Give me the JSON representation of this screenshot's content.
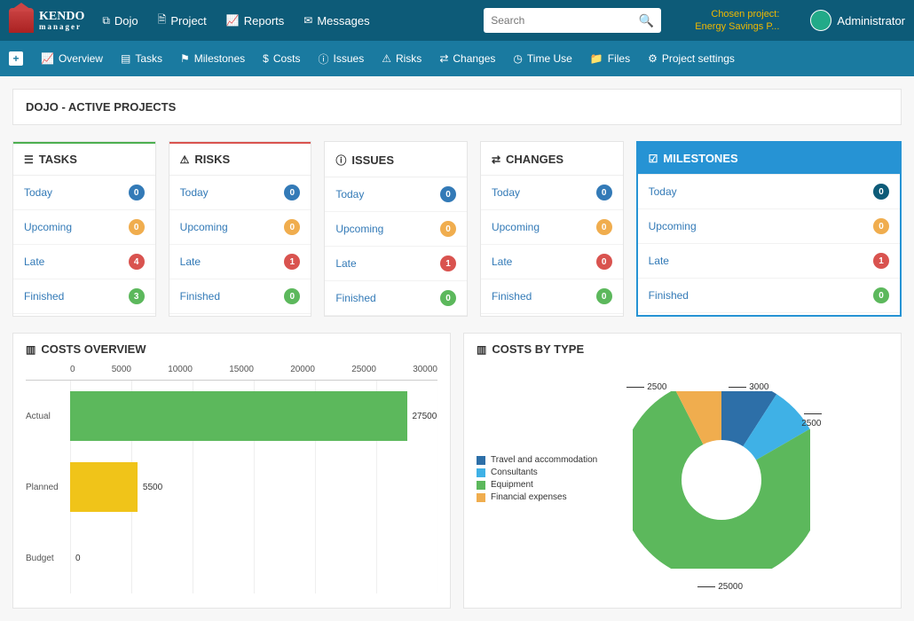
{
  "app": {
    "name": "KENDO",
    "subtitle": "manager"
  },
  "topnav": {
    "dojo": "Dojo",
    "project": "Project",
    "reports": "Reports",
    "messages": "Messages"
  },
  "search": {
    "placeholder": "Search"
  },
  "chosen": {
    "label": "Chosen project:",
    "value": "Energy Savings P..."
  },
  "user": {
    "name": "Administrator"
  },
  "subnav": {
    "overview": "Overview",
    "tasks": "Tasks",
    "milestones": "Milestones",
    "costs": "Costs",
    "issues": "Issues",
    "risks": "Risks",
    "changes": "Changes",
    "timeuse": "Time Use",
    "files": "Files",
    "settings": "Project settings"
  },
  "page_title": "DOJO - ACTIVE PROJECTS",
  "summary_labels": {
    "tasks": "TASKS",
    "risks": "RISKS",
    "issues": "ISSUES",
    "changes": "CHANGES",
    "milestones": "MILESTONES",
    "today": "Today",
    "upcoming": "Upcoming",
    "late": "Late",
    "finished": "Finished"
  },
  "summary": {
    "tasks": {
      "today": "0",
      "upcoming": "0",
      "late": "4",
      "finished": "3"
    },
    "risks": {
      "today": "0",
      "upcoming": "0",
      "late": "1",
      "finished": "0"
    },
    "issues": {
      "today": "0",
      "upcoming": "0",
      "late": "1",
      "finished": "0"
    },
    "changes": {
      "today": "0",
      "upcoming": "0",
      "late": "0",
      "finished": "0"
    },
    "milestones": {
      "today": "0",
      "upcoming": "0",
      "late": "1",
      "finished": "0"
    }
  },
  "costs_overview": {
    "title": "COSTS OVERVIEW"
  },
  "costs_by_type": {
    "title": "COSTS BY TYPE"
  },
  "chart_data": [
    {
      "id": "costs_overview",
      "type": "bar",
      "orientation": "horizontal",
      "categories": [
        "Actual",
        "Planned",
        "Budget"
      ],
      "values": [
        27500,
        5500,
        0
      ],
      "colors": [
        "#5cb85c",
        "#f0c419",
        "#999999"
      ],
      "xlim": [
        0,
        30000
      ],
      "xticks": [
        0,
        5000,
        10000,
        15000,
        20000,
        25000,
        30000
      ]
    },
    {
      "id": "costs_by_type",
      "type": "pie",
      "donut": true,
      "series": [
        {
          "name": "Travel and accommodation",
          "value": 3000,
          "color": "#2d6fa8"
        },
        {
          "name": "Consultants",
          "value": 2500,
          "color": "#3fb1e6"
        },
        {
          "name": "Equipment",
          "value": 25000,
          "color": "#5cb85c"
        },
        {
          "name": "Financial expenses",
          "value": 2500,
          "color": "#f0ad4e"
        }
      ]
    }
  ]
}
